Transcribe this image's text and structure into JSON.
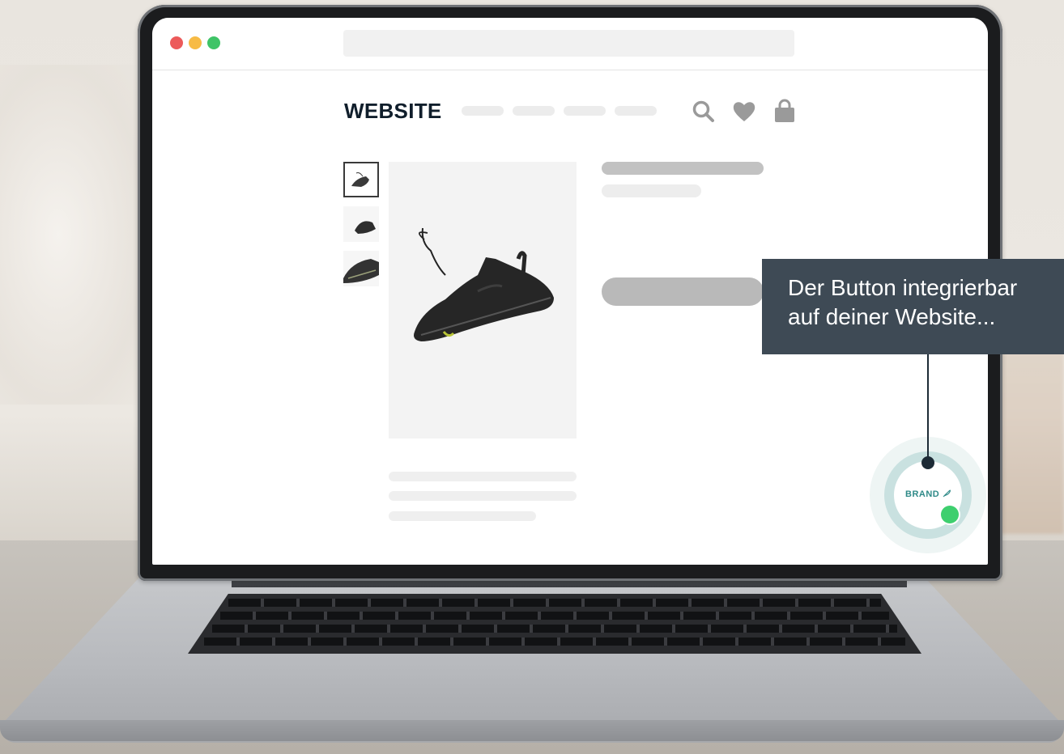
{
  "browser": {
    "window_dots": [
      {
        "name": "close",
        "color": "#ec5a5a"
      },
      {
        "name": "minimize",
        "color": "#f7bb45"
      },
      {
        "name": "maximize",
        "color": "#3fc467"
      }
    ]
  },
  "site": {
    "logo": "WEBSITE",
    "nav_items_count_placeholder": "",
    "header_icons": [
      "search-icon",
      "heart-icon",
      "shopping-bag-icon"
    ],
    "accent_colors": {
      "logo": "#101e2b",
      "placeholder": "#b9b9b9",
      "light_placeholder": "#ececec"
    }
  },
  "product": {
    "thumbnails": [
      "shoe-thumb-1",
      "shoe-thumb-2",
      "shoe-thumb-3"
    ],
    "main_image": "shoe-image"
  },
  "widget": {
    "brand_label": "BRAND",
    "brand_icon": "feather-icon",
    "status_color": "#3ecf6e",
    "ring_color": "#c9e1e0"
  },
  "tooltip": {
    "line1": "Der Button integrierbar",
    "line2": "auf deiner Website..."
  }
}
